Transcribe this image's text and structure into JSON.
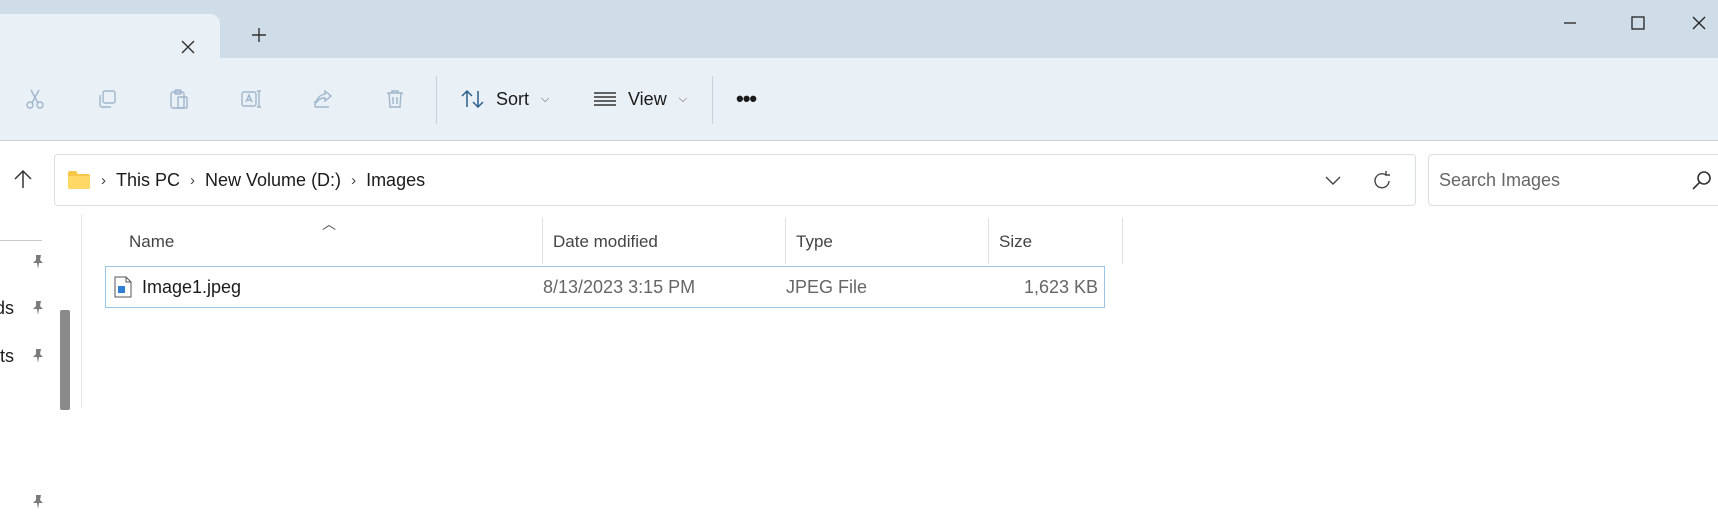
{
  "toolbar": {
    "sort_label": "Sort",
    "view_label": "View",
    "more_label": "•••",
    "icons": [
      "cut-icon",
      "copy-icon",
      "paste-icon",
      "rename-icon",
      "share-icon",
      "delete-icon"
    ]
  },
  "address": {
    "crumbs": [
      "This PC",
      "New Volume (D:)",
      "Images"
    ]
  },
  "search": {
    "placeholder": "Search Images"
  },
  "nav": {
    "items": [
      {
        "label": "ds"
      },
      {
        "label": "nts"
      }
    ]
  },
  "columns": {
    "name": "Name",
    "date": "Date modified",
    "type": "Type",
    "size": "Size"
  },
  "files": [
    {
      "name": "Image1.jpeg",
      "date": "8/13/2023 3:15 PM",
      "type": "JPEG File",
      "size": "1,623 KB"
    }
  ],
  "colors": {
    "titlebar": "#cfdde9",
    "toolbar": "#e9f0f6",
    "selection_border": "#99c5e8",
    "folder": "#f5c84c"
  }
}
